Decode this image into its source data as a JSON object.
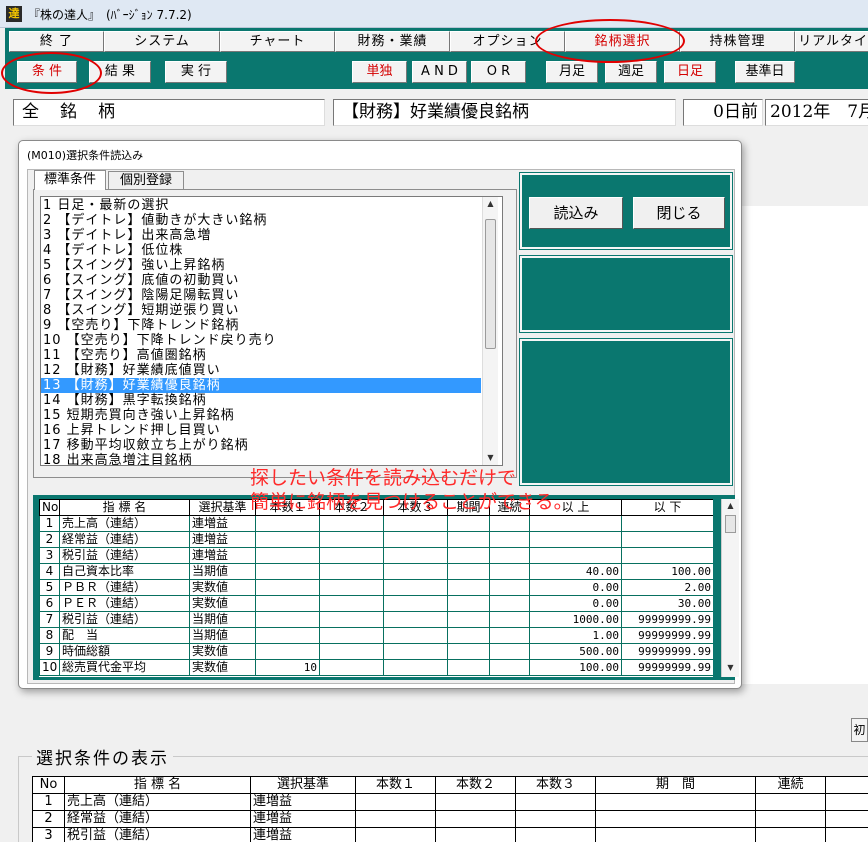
{
  "window": {
    "icon_text": "達",
    "title": "『株の達人』　(ﾊﾞｰｼﾞｮﾝ 7.7.2)"
  },
  "nav": [
    "終 了",
    "システム",
    "チャート",
    "財務・業績",
    "オプション",
    "銘柄選択",
    "持株管理",
    "リアルタイム"
  ],
  "toolbar": {
    "condition": "条 件",
    "result": "結 果",
    "run": "実 行",
    "single": "単独",
    "and": "A N D",
    "or": "O R",
    "monthly": "月足",
    "weekly": "週足",
    "daily": "日足",
    "base_date": "基準日"
  },
  "header": {
    "scope": "全　銘　柄",
    "screen_name": "【財務】好業績優良銘柄",
    "days_ago": "0日前",
    "date": "2012年　7月"
  },
  "bg_button": "初",
  "selection_display": {
    "title": "選択条件の表示",
    "headers": [
      "No",
      "指 標 名",
      "選択基準",
      "本数１",
      "本数２",
      "本数３",
      "期　間",
      "連続"
    ],
    "rows": [
      [
        "1",
        "売上高（連結）",
        "連増益",
        "",
        "",
        "",
        "",
        ""
      ],
      [
        "2",
        "経常益（連結）",
        "連増益",
        "",
        "",
        "",
        "",
        ""
      ],
      [
        "3",
        "税引益（連結）",
        "連増益",
        "",
        "",
        "",
        "",
        ""
      ]
    ]
  },
  "dialog": {
    "title": "(M010)選択条件読込み",
    "tabs": [
      "標準条件",
      "個別登録"
    ],
    "load_button": "読込み",
    "close_button": "閉じる",
    "list": [
      "1 日足・最新の選択",
      "2 【デイトレ】値動きが大きい銘柄",
      "3 【デイトレ】出来高急増",
      "4 【デイトレ】低位株",
      "5 【スイング】強い上昇銘柄",
      "6 【スイング】底値の初動買い",
      "7 【スイング】陰陽足陽転買い",
      "8 【スイング】短期逆張り買い",
      "9 【空売り】下降トレンド銘柄",
      "10 【空売り】下降トレンド戻り売り",
      "11 【空売り】高値圏銘柄",
      "12 【財務】好業績底値買い",
      "13 【財務】好業績優良銘柄",
      "14 【財務】黒字転換銘柄",
      "15 短期売買向き強い上昇銘柄",
      "16 上昇トレンド押し目買い",
      "17 移動平均収斂立ち上がり銘柄",
      "18 出来高急増注目銘柄"
    ],
    "selected_index": 12,
    "grid_headers": [
      "No",
      "指 標 名",
      "選択基準",
      "本数１",
      "本数２",
      "本数３",
      "期間",
      "連続",
      "以 上",
      "以 下"
    ],
    "grid_rows": [
      [
        "1",
        "売上高（連結）",
        "連増益",
        "",
        "",
        "",
        "",
        "",
        "",
        ""
      ],
      [
        "2",
        "経常益（連結）",
        "連増益",
        "",
        "",
        "",
        "",
        "",
        "",
        ""
      ],
      [
        "3",
        "税引益（連結）",
        "連増益",
        "",
        "",
        "",
        "",
        "",
        "",
        ""
      ],
      [
        "4",
        "自己資本比率",
        "当期値",
        "",
        "",
        "",
        "",
        "",
        "40.00",
        "100.00"
      ],
      [
        "5",
        "ＰＢＲ（連結）",
        "実数値",
        "",
        "",
        "",
        "",
        "",
        "0.00",
        "2.00"
      ],
      [
        "6",
        "ＰＥＲ（連結）",
        "実数値",
        "",
        "",
        "",
        "",
        "",
        "0.00",
        "30.00"
      ],
      [
        "7",
        "税引益（連結）",
        "当期値",
        "",
        "",
        "",
        "",
        "",
        "1000.00",
        "99999999.99"
      ],
      [
        "8",
        "配　当",
        "当期値",
        "",
        "",
        "",
        "",
        "",
        "1.00",
        "99999999.99"
      ],
      [
        "9",
        "時価総額",
        "実数値",
        "",
        "",
        "",
        "",
        "",
        "500.00",
        "99999999.99"
      ],
      [
        "10",
        "総売買代金平均",
        "実数値",
        "10",
        "",
        "",
        "",
        "",
        "100.00",
        "99999999.99"
      ]
    ]
  },
  "annotation": {
    "line1": "探したい条件を読み込むだけで",
    "line2": "簡単に銘柄を見つけることができる。"
  },
  "accent": {
    "teal": "#0a776f",
    "selection": "#3399ff",
    "highlight_red": "#e00000"
  }
}
